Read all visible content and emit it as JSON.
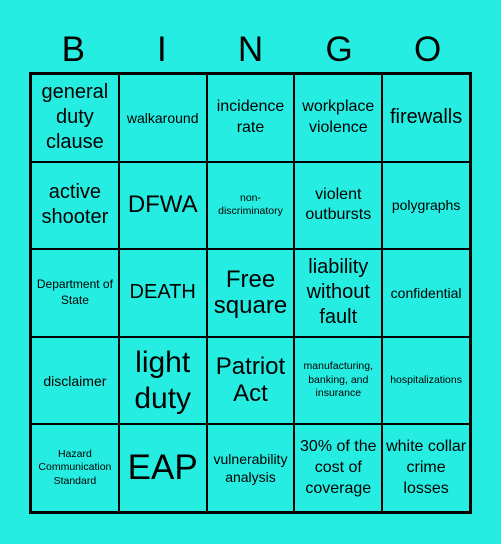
{
  "header": [
    "B",
    "I",
    "N",
    "G",
    "O"
  ],
  "cells": [
    {
      "text": "general duty clause",
      "size": "s-m"
    },
    {
      "text": "walkaround",
      "size": "s-s"
    },
    {
      "text": "incidence rate",
      "size": "s-sm"
    },
    {
      "text": "workplace violence",
      "size": "s-sm"
    },
    {
      "text": "firewalls",
      "size": "s-m"
    },
    {
      "text": "active shooter",
      "size": "s-m"
    },
    {
      "text": "DFWA",
      "size": "s-ml"
    },
    {
      "text": "non-discriminatory",
      "size": "s-xxs"
    },
    {
      "text": "violent outbursts",
      "size": "s-sm"
    },
    {
      "text": "polygraphs",
      "size": "s-s"
    },
    {
      "text": "Department of State",
      "size": "s-xs"
    },
    {
      "text": "DEATH",
      "size": "s-m"
    },
    {
      "text": "Free square",
      "size": "s-ml"
    },
    {
      "text": "liability without fault",
      "size": "s-m"
    },
    {
      "text": "confidential",
      "size": "s-s"
    },
    {
      "text": "disclaimer",
      "size": "s-s"
    },
    {
      "text": "light duty",
      "size": "s-l"
    },
    {
      "text": "Patriot Act",
      "size": "s-ml"
    },
    {
      "text": "manufacturing, banking, and insurance",
      "size": "s-xxs"
    },
    {
      "text": "hospitalizations",
      "size": "s-xxs"
    },
    {
      "text": "Hazard Communication Standard",
      "size": "s-xxs"
    },
    {
      "text": "EAP",
      "size": "s-xl"
    },
    {
      "text": "vulnerability analysis",
      "size": "s-s"
    },
    {
      "text": "30% of the cost of coverage",
      "size": "s-sm"
    },
    {
      "text": "white collar crime losses",
      "size": "s-sm"
    }
  ]
}
